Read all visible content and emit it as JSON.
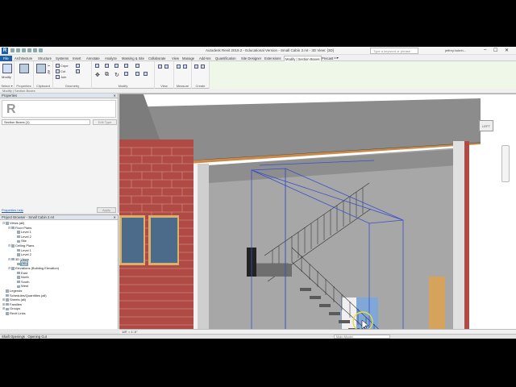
{
  "titlebar": {
    "app_title": "Autodesk Revit 2019.2 - Educational Version -    Small Cabin 2.rvt - 3D View: {3D}",
    "search_placeholder": "Type a keyword or phrase",
    "user": "jeffrey.hobrin...",
    "min": "–",
    "max": "☐",
    "close": "✕"
  },
  "tabs": [
    "File",
    "Architecture",
    "Structure",
    "Systems",
    "Insert",
    "Annotate",
    "Analyze",
    "Massing & Site",
    "Collaborate",
    "View",
    "Manage",
    "Add-Ins",
    "Quantification",
    "Site Designer",
    "Extensions",
    "Modify | Section Boxes",
    "Precast"
  ],
  "active_tab": "Modify | Section Boxes",
  "ribbon": {
    "modify": "Modify",
    "select": "Select ▾",
    "properties": "Properties",
    "clipboard": "Clipboard",
    "cope": "Cope",
    "cut": "Cut",
    "join": "Join",
    "geometry": "Geometry",
    "modify_group": "Modify",
    "view": "View",
    "measure": "Measure",
    "create": "Create"
  },
  "context_line": "Modify | Section Boxes",
  "properties": {
    "header": "Properties",
    "close": "✕",
    "type": "Section Boxes (1)",
    "edit_type": "Edit Type",
    "help": "Properties help",
    "apply": "Apply"
  },
  "browser": {
    "header": "Project Browser - Small Cabin 2.rvt",
    "close": "✕",
    "nodes": [
      {
        "label": "Views (all)",
        "toggle": "⊟",
        "level": 0
      },
      {
        "label": "Floor Plans",
        "toggle": "⊟",
        "level": 1
      },
      {
        "label": "Level 1",
        "toggle": "",
        "level": 2
      },
      {
        "label": "Level 2",
        "toggle": "",
        "level": 2
      },
      {
        "label": "Site",
        "toggle": "",
        "level": 2
      },
      {
        "label": "Ceiling Plans",
        "toggle": "⊟",
        "level": 1
      },
      {
        "label": "Level 1",
        "toggle": "",
        "level": 2
      },
      {
        "label": "Level 2",
        "toggle": "",
        "level": 2
      },
      {
        "label": "3D Views",
        "toggle": "⊟",
        "level": 1
      },
      {
        "label": "{3D}",
        "toggle": "",
        "level": 2,
        "selected": true
      },
      {
        "label": "Elevations (Building Elevation)",
        "toggle": "⊟",
        "level": 1
      },
      {
        "label": "East",
        "toggle": "",
        "level": 2
      },
      {
        "label": "North",
        "toggle": "",
        "level": 2
      },
      {
        "label": "South",
        "toggle": "",
        "level": 2
      },
      {
        "label": "West",
        "toggle": "",
        "level": 2
      },
      {
        "label": "Legends",
        "toggle": "",
        "level": 0
      },
      {
        "label": "Schedules/Quantities (all)",
        "toggle": "",
        "level": 0
      },
      {
        "label": "Sheets (all)",
        "toggle": "⊞",
        "level": 0
      },
      {
        "label": "Families",
        "toggle": "⊞",
        "level": 0
      },
      {
        "label": "Groups",
        "toggle": "⊞",
        "level": 0
      },
      {
        "label": "Revit Links",
        "toggle": "",
        "level": 0
      }
    ]
  },
  "viewcube": "LEFT",
  "view_scale": "1/8\" = 1'-0\"",
  "status": "Shaft Openings : Opening Cut",
  "model_select": "Main Model",
  "colors": {
    "accent": "#1c5fa8",
    "context_tab": "#eef7e8",
    "brick": "#b5453f",
    "section_box": "#3a4fc9"
  }
}
